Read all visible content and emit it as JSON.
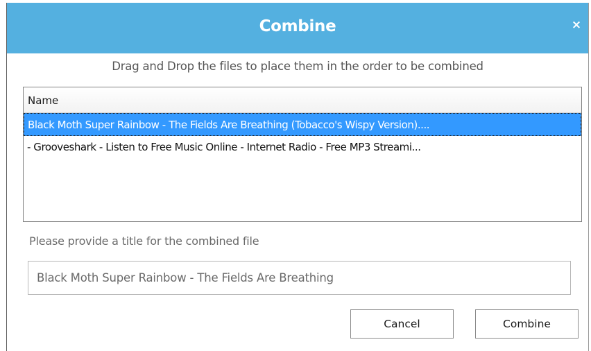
{
  "dialog": {
    "title": "Combine",
    "close_icon": "×",
    "instructions": "Drag and Drop the files to place them in the order to be combined"
  },
  "file_list": {
    "column_header": "Name",
    "rows": [
      {
        "name": "Black Moth Super Rainbow - The Fields Are Breathing (Tobacco's Wispy Version)....",
        "selected": true
      },
      {
        "name": "- Grooveshark - Listen to Free Music Online - Internet Radio - Free MP3 Streami...",
        "selected": false
      }
    ]
  },
  "title_prompt": {
    "label": "Please provide a title for the combined file",
    "value": "Black Moth Super Rainbow - The Fields Are Breathing"
  },
  "buttons": {
    "cancel": "Cancel",
    "combine": "Combine"
  },
  "colors": {
    "titlebar": "#54b0e0",
    "selection": "#3399ff"
  }
}
